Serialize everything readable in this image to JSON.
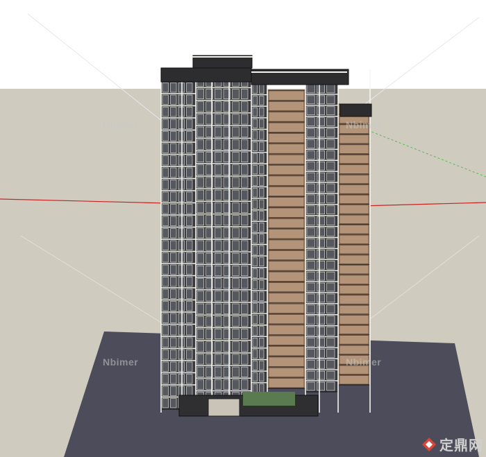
{
  "watermark": {
    "label": "Nbimer"
  },
  "logo": {
    "text": "定鼎网"
  },
  "colors": {
    "sky": "#ffffff",
    "ground": "#cfcbbf",
    "base_plate": "#4c4c5a",
    "facade_dark": "#3a3a3e",
    "facade_brown": "#a88a72",
    "frame_white": "#f5f5f0",
    "axis_red": "#cc2222",
    "axis_green": "#55bb55",
    "axis_blue": "#3344aa"
  },
  "building": {
    "floor_count": 28,
    "description_icon": "high-rise-3d-model"
  }
}
